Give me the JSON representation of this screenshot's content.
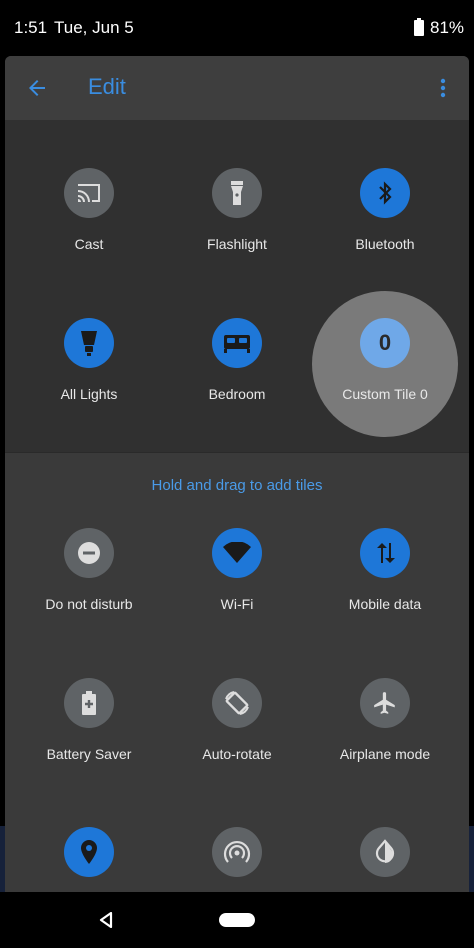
{
  "status_bar": {
    "time": "1:51",
    "date": "Tue, Jun 5",
    "battery": "81%"
  },
  "header": {
    "title": "Edit",
    "back_icon": "arrow-left-icon",
    "more_icon": "more-vert-icon"
  },
  "current_tiles": [
    {
      "label": "Cast",
      "icon": "cast-icon",
      "state": "off"
    },
    {
      "label": "Flashlight",
      "icon": "flashlight-icon",
      "state": "off"
    },
    {
      "label": "Bluetooth",
      "icon": "bluetooth-icon",
      "state": "on"
    },
    {
      "label": "All Lights",
      "icon": "light-bulb-icon",
      "state": "on"
    },
    {
      "label": "Bedroom",
      "icon": "bed-icon",
      "state": "on"
    },
    {
      "label": "Custom Tile 0",
      "icon": "custom-tile-icon",
      "glyph": "0",
      "state": "dragging"
    }
  ],
  "hint": "Hold and drag to add tiles",
  "available_tiles": [
    {
      "label": "Do not disturb",
      "icon": "do-not-disturb-icon",
      "state": "off"
    },
    {
      "label": "Wi-Fi",
      "icon": "wifi-icon",
      "state": "on"
    },
    {
      "label": "Mobile data",
      "icon": "mobile-data-icon",
      "state": "on"
    },
    {
      "label": "Battery Saver",
      "icon": "battery-saver-icon",
      "state": "off"
    },
    {
      "label": "Auto-rotate",
      "icon": "auto-rotate-icon",
      "state": "off"
    },
    {
      "label": "Airplane mode",
      "icon": "airplane-icon",
      "state": "off"
    },
    {
      "label": "",
      "icon": "location-icon",
      "state": "on"
    },
    {
      "label": "",
      "icon": "hotspot-icon",
      "state": "off"
    },
    {
      "label": "",
      "icon": "invert-colors-icon",
      "state": "off"
    }
  ],
  "colors": {
    "accent": "#1e77d8",
    "hint_text": "#4a9be8",
    "tile_off": "#5f6366"
  }
}
